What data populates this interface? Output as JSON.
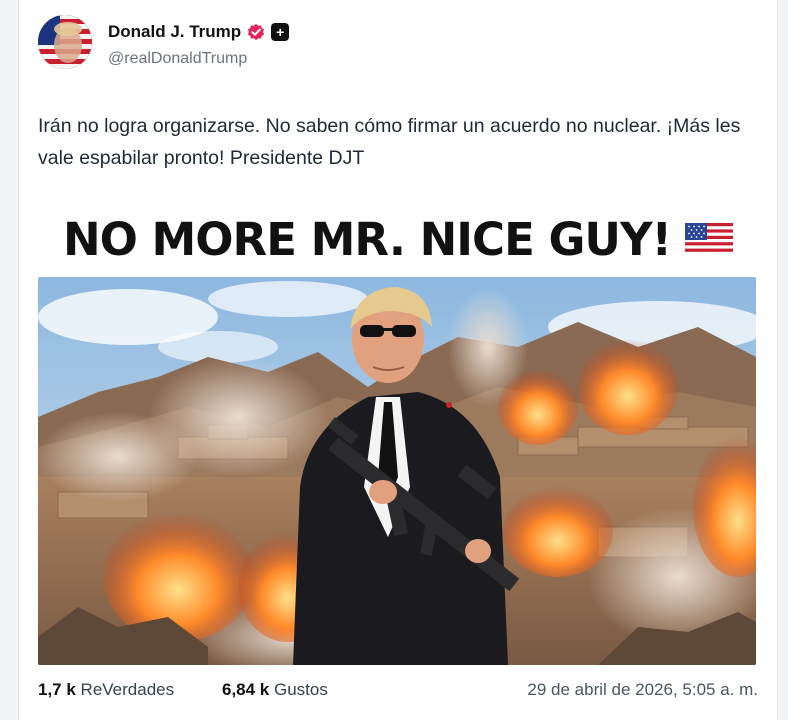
{
  "post": {
    "author": {
      "display_name": "Donald J. Trump",
      "handle": "@realDonaldTrump",
      "verified_icon": "verified-badge-icon",
      "badge_icon": "plus-badge-icon",
      "badge_glyph": "+"
    },
    "text": "Irán no logra organizarse. No saben cómo firmar un acuerdo no nuclear. ¡Más les vale espabilar pronto! Presidente DJT",
    "image": {
      "headline": "NO MORE MR. NICE GUY!",
      "flag_icon": "us-flag-icon"
    },
    "stats": {
      "reposts_count": "1,7 k",
      "reposts_label": "ReVerdades",
      "likes_count": "6,84 k",
      "likes_label": "Gustos"
    },
    "timestamp": "29 de abril de 2026, 5:05 a. m."
  },
  "colors": {
    "verified": "#e0245e",
    "text": "#1f2937",
    "muted": "#6b7280"
  }
}
